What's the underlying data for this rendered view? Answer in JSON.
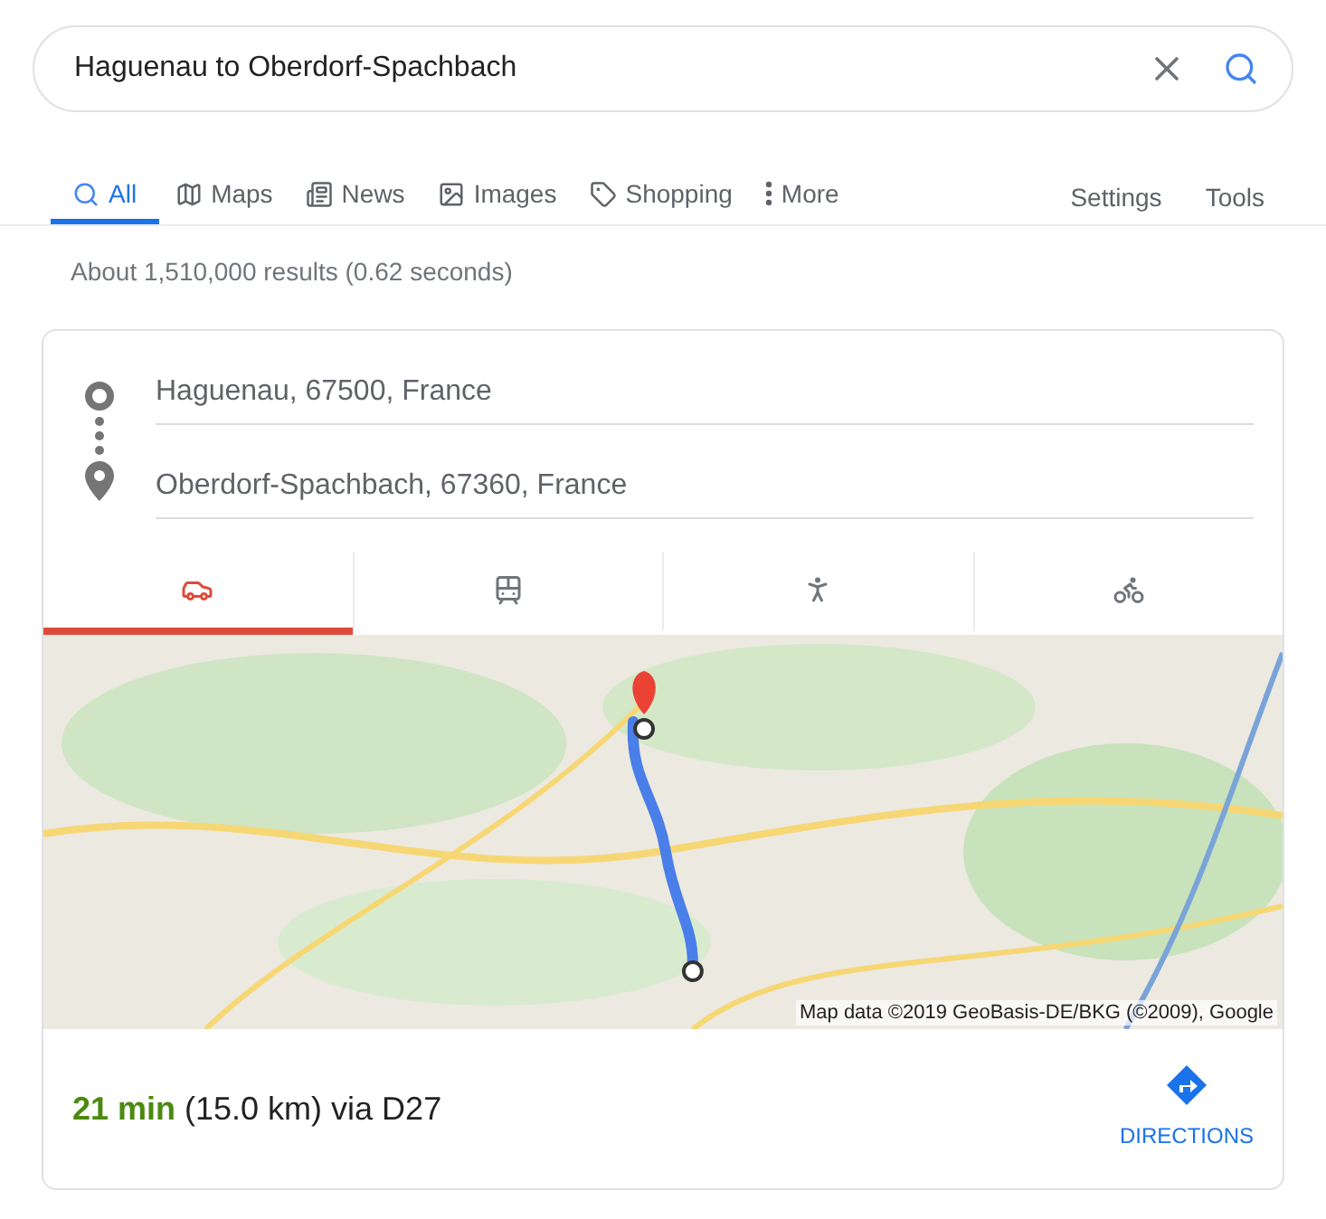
{
  "search": {
    "value": "Haguenau to Oberdorf-Spachbach"
  },
  "tabs": [
    {
      "kind": "all",
      "label": "All",
      "selected": true
    },
    {
      "kind": "maps",
      "label": "Maps",
      "selected": false
    },
    {
      "kind": "news",
      "label": "News",
      "selected": false
    },
    {
      "kind": "images",
      "label": "Images",
      "selected": false
    },
    {
      "kind": "shopping",
      "label": "Shopping",
      "selected": false
    },
    {
      "kind": "more",
      "label": "More",
      "selected": false
    }
  ],
  "tools": [
    "Settings",
    "Tools"
  ],
  "result_stats": "About 1,510,000 results (0.62 seconds)",
  "directions": {
    "origin": "Haguenau, 67500, France",
    "destination": "Oberdorf-Spachbach, 67360, France",
    "modes": [
      {
        "kind": "car",
        "selected": true
      },
      {
        "kind": "transit",
        "selected": false
      },
      {
        "kind": "walk",
        "selected": false
      },
      {
        "kind": "bike",
        "selected": false
      }
    ],
    "map": {
      "kind": "picture",
      "attribution": "Map data ©2019 GeoBasis-DE/BKG (©2009), Google"
    },
    "summary": "**21 min** (15.0 km) via D27",
    "action": "DIRECTIONS"
  }
}
